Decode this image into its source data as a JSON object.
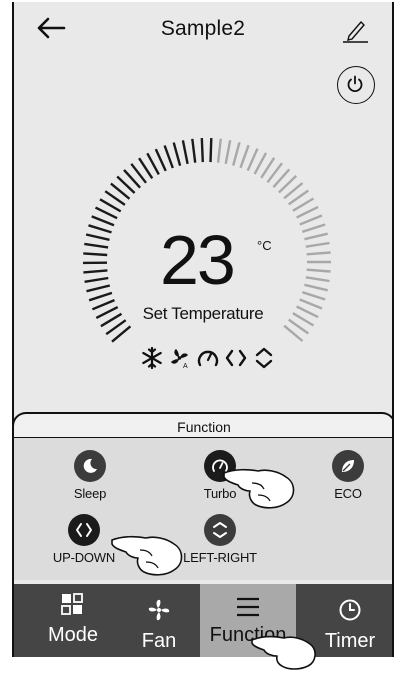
{
  "header": {
    "title": "Sample2",
    "back_icon": "back-arrow-icon",
    "edit_icon": "pencil-icon"
  },
  "power_icon": "power-icon",
  "thermostat": {
    "temperature": "23",
    "unit": "°C",
    "label": "Set Temperature",
    "mode_icons": [
      "snowflake-icon",
      "fan-auto-icon",
      "turbo-icon",
      "swing-updown-icon",
      "swing-leftright-icon"
    ]
  },
  "function_panel": {
    "title": "Function",
    "buttons": [
      {
        "label": "Sleep",
        "icon": "moon-icon"
      },
      {
        "label": "Turbo",
        "icon": "speedometer-icon"
      },
      {
        "label": "ECO",
        "icon": "leaf-icon"
      },
      {
        "label": "UP-DOWN",
        "icon": "swing-updown-icon"
      },
      {
        "label": "LEFT-RIGHT",
        "icon": "swing-leftright-icon"
      }
    ]
  },
  "bottom_nav": {
    "items": [
      {
        "label": "Mode",
        "icon": "mode-grid-icon"
      },
      {
        "label": "Fan",
        "icon": "fan-icon"
      },
      {
        "label": "Function",
        "icon": "menu-lines-icon",
        "active": true
      },
      {
        "label": "Timer",
        "icon": "clock-icon"
      }
    ]
  },
  "colors": {
    "screen_bg": "#e9e9e9",
    "function_bg": "#dcdcdc",
    "nav_bg": "#454545",
    "nav_active": "#a9a9a9",
    "button_dark": "#3c3c3c"
  }
}
